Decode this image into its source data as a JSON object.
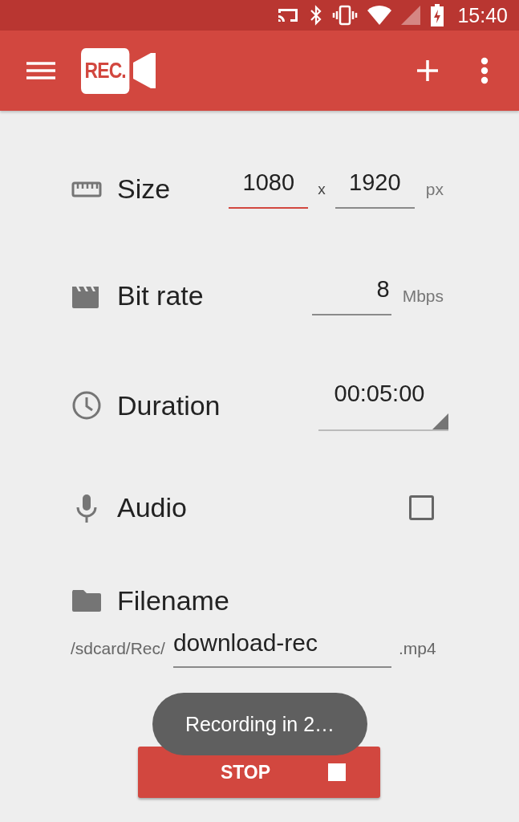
{
  "status_bar": {
    "time": "15:40"
  },
  "toolbar": {
    "logo": "REC."
  },
  "settings": [
    {
      "kind": "size",
      "label": "Size",
      "width": {
        "value": "1080",
        "focused": true
      },
      "separator": "x",
      "height": {
        "value": "1920",
        "focused": false
      },
      "unit": "px"
    },
    {
      "kind": "bitrate",
      "label": "Bit rate",
      "value": "8",
      "unit": "Mbps"
    },
    {
      "kind": "duration",
      "label": "Duration",
      "value": "00:05:00"
    },
    {
      "kind": "audio",
      "label": "Audio",
      "checked": false
    },
    {
      "kind": "filename",
      "label": "Filename",
      "prefix": "/sdcard/Rec/",
      "value": "download-rec",
      "suffix": ".mp4"
    }
  ],
  "stop_button": {
    "label": "STOP"
  },
  "toast": {
    "message": "Recording in 2…"
  }
}
